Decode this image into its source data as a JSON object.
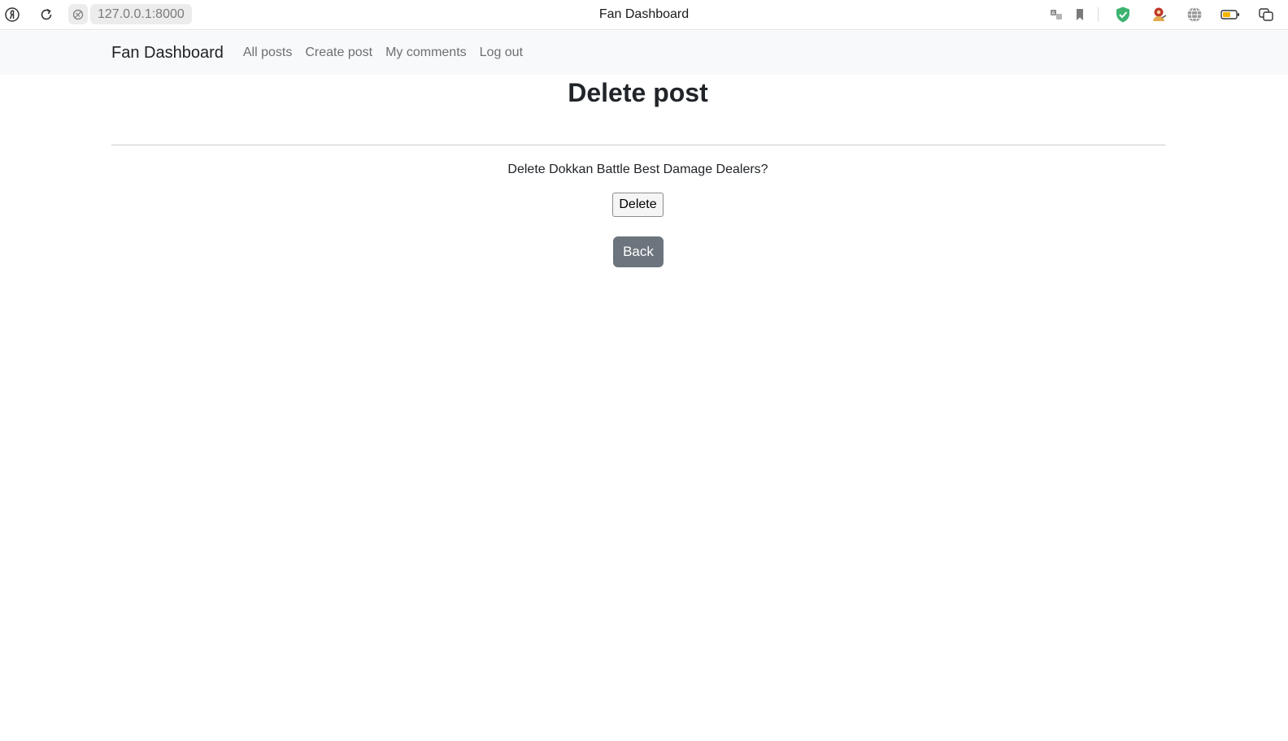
{
  "browser": {
    "url": "127.0.0.1:8000",
    "tab_title": "Fan Dashboard",
    "icons": {
      "profile": "yandex-logo-icon",
      "reload": "reload-icon",
      "site_info": "site-info-icon",
      "translate": "translate-icon",
      "bookmark": "bookmark-icon",
      "shield": "shield-check-icon",
      "extension": "extension-avatar-icon",
      "globe": "globe-icon",
      "battery": "battery-icon",
      "sidebar": "sidebar-icon"
    },
    "colors": {
      "shield": "#3cb371",
      "battery": "#f4b400"
    }
  },
  "navbar": {
    "brand": "Fan Dashboard",
    "links": [
      "All posts",
      "Create post",
      "My comments",
      "Log out"
    ]
  },
  "main": {
    "title": "Delete post",
    "confirm_text": "Delete Dokkan Battle Best Damage Dealers?",
    "delete_label": "Delete",
    "back_label": "Back"
  },
  "colors": {
    "navbar_bg": "#f8f9fa",
    "secondary_button": "#6c757d",
    "text": "#212529"
  }
}
